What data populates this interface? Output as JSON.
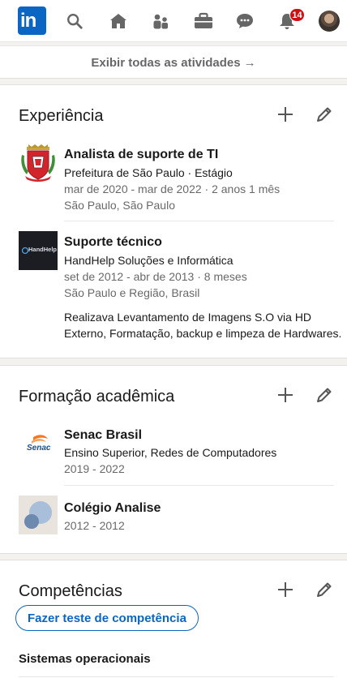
{
  "nav": {
    "logo_text": "in",
    "notifications_count": "14",
    "icons": [
      "search-icon",
      "home-icon",
      "network-icon",
      "jobs-icon",
      "messaging-icon",
      "notifications-icon"
    ]
  },
  "activity": {
    "show_all_label": "Exibir todas as atividades",
    "arrow": "→"
  },
  "experience": {
    "title": "Experiência",
    "items": [
      {
        "title": "Analista de suporte de TI",
        "company": "Prefeitura de São Paulo · Estágio",
        "dates": "mar de 2020 - mar de 2022 · 2 anos 1 mês",
        "location": "São Paulo, São Paulo"
      },
      {
        "title": "Suporte técnico",
        "company": "HandHelp Soluções e Informática",
        "dates": "set de 2012 - abr de 2013 · 8 meses",
        "location": "São Paulo e Região, Brasil",
        "description_line1": "Realizava Levantamento de Imagens S.O via HD",
        "description_line2": "Externo, Formatação, backup e limpeza de Hardwares.",
        "logo_text": "HandHelp"
      }
    ]
  },
  "education": {
    "title": "Formação acadêmica",
    "items": [
      {
        "school": "Senac Brasil",
        "degree": "Ensino Superior, Redes de Computadores",
        "years": "2019 - 2022",
        "logo_text": "Senac"
      },
      {
        "school": "Colégio Analise",
        "years": "2012 - 2012"
      }
    ]
  },
  "skills": {
    "title": "Competências",
    "test_button": "Fazer teste de competência",
    "items": [
      "Sistemas operacionais"
    ]
  },
  "colors": {
    "brand_blue": "#0a66c2",
    "badge_red": "#cc1016",
    "page_bg": "#f3f2ef"
  }
}
